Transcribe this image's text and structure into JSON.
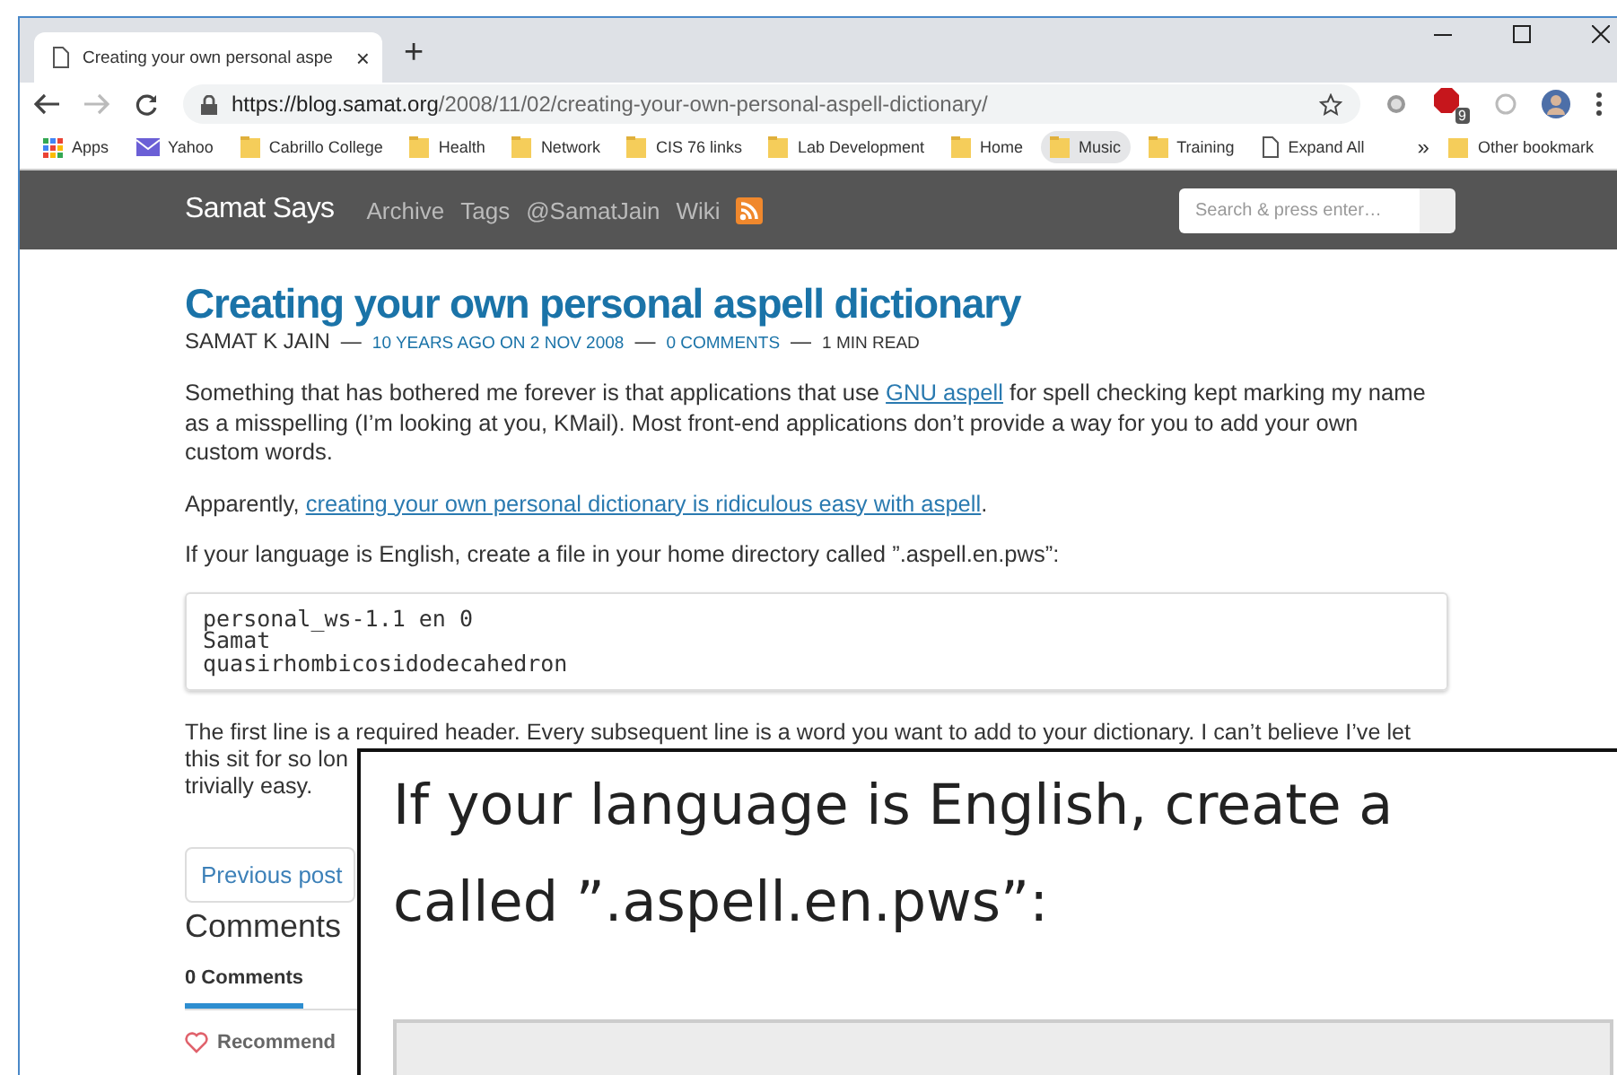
{
  "browser": {
    "tab_title": "Creating your own personal aspe",
    "tab_close": "×",
    "new_tab": "+",
    "url_host": "https://blog.samat.org",
    "url_path": "/2008/11/02/creating-your-own-personal-aspell-dictionary/",
    "extension_badge": "9",
    "bookmarks": [
      {
        "kind": "apps",
        "label": "Apps",
        "highlighted": false
      },
      {
        "kind": "mail",
        "label": "Yahoo",
        "highlighted": false
      },
      {
        "kind": "folder",
        "label": "Cabrillo College",
        "highlighted": false
      },
      {
        "kind": "folder",
        "label": "Health",
        "highlighted": false
      },
      {
        "kind": "folder",
        "label": "Network",
        "highlighted": false
      },
      {
        "kind": "folder",
        "label": "CIS 76 links",
        "highlighted": false
      },
      {
        "kind": "folder",
        "label": "Lab Development",
        "highlighted": false
      },
      {
        "kind": "folder",
        "label": "Home",
        "highlighted": false
      },
      {
        "kind": "folder",
        "label": "Music",
        "highlighted": true
      },
      {
        "kind": "folder",
        "label": "Training",
        "highlighted": false
      },
      {
        "kind": "page",
        "label": "Expand All",
        "highlighted": false
      }
    ],
    "more_bookmarks": "»",
    "other_bookmarks": "Other bookmark"
  },
  "site": {
    "brand": "Samat Says",
    "nav": [
      "Archive",
      "Tags",
      "@SamatJain",
      "Wiki"
    ],
    "search": {
      "placeholder": "Search & press enter…"
    }
  },
  "article": {
    "title": "Creating your own personal aspell dictionary",
    "meta": [
      {
        "text": "SAMAT K JAIN",
        "kind": "author"
      },
      {
        "text": "—",
        "kind": "sep"
      },
      {
        "text": "10 YEARS AGO ON 2 NOV 2008",
        "kind": "link"
      },
      {
        "text": "—",
        "kind": "sep"
      },
      {
        "text": "0 COMMENTS",
        "kind": "link"
      },
      {
        "text": "—",
        "kind": "sep"
      },
      {
        "text": "1 MIN READ",
        "kind": "plain"
      }
    ],
    "paragraphs": [
      [
        {
          "text": "Something that has bothered me forever is that applications that use ",
          "kind": "text"
        },
        {
          "text": "GNU aspell",
          "kind": "link"
        },
        {
          "text": " for spell checking kept marking my name as a misspelling (I’m looking at you, KMail). Most front-end applications don’t provide a way for you to add your own custom words.",
          "kind": "text"
        }
      ],
      [
        {
          "text": "Apparently, ",
          "kind": "text"
        },
        {
          "text": "creating your own personal dictionary is ridiculous easy with aspell",
          "kind": "link"
        },
        {
          "text": ".",
          "kind": "text"
        }
      ],
      [
        {
          "text": "If your language is English, create a file in your home directory called ”.aspell.en.pws”:",
          "kind": "text"
        }
      ]
    ],
    "code": [
      "personal_ws-1.1 en 0",
      "Samat",
      "quasirhombicosidodecahedron"
    ],
    "covered_lines": [
      "The first line is a required header. Every subsequent line is a word you want to add to your dictionary. I can’t believe I’ve let",
      "this sit for so lon",
      "trivially easy."
    ],
    "previous_post": "Previous post"
  },
  "comments": {
    "heading": "Comments",
    "tabs": [
      {
        "label": "0 Comments",
        "selected": true
      }
    ],
    "recommend": "Recommend"
  },
  "magnifier": {
    "lines": [
      "If your language is English, create a",
      "called ”.aspell.en.pws”:"
    ]
  }
}
